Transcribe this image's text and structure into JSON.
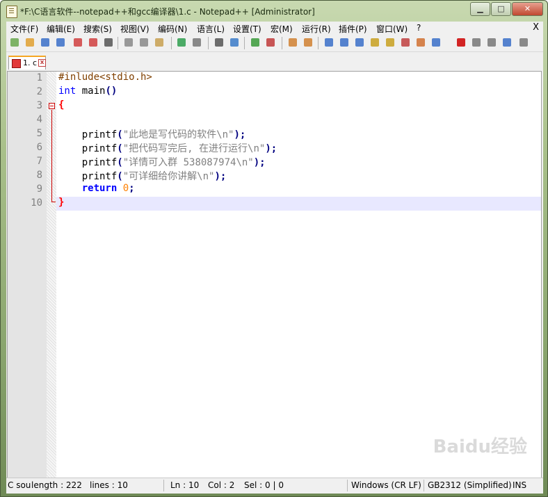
{
  "window": {
    "title": "*F:\\C语言软件--notepad++和gcc编译器\\1.c - Notepad++ [Administrator]",
    "minimize": "▁",
    "maximize": "□",
    "close": "✕"
  },
  "menu": {
    "items": [
      "文件(F)",
      "编辑(E)",
      "搜索(S)",
      "视图(V)",
      "编码(N)",
      "语言(L)",
      "设置(T)",
      "宏(M)",
      "运行(R)",
      "插件(P)",
      "窗口(W)",
      "?"
    ],
    "close_label": "X"
  },
  "toolbar": {
    "icons": [
      "new-file-icon",
      "open-file-icon",
      "save-icon",
      "save-all-icon",
      "close-icon",
      "close-all-icon",
      "print-icon",
      "cut-icon",
      "copy-icon",
      "paste-icon",
      "undo-icon",
      "redo-icon",
      "find-icon",
      "replace-icon",
      "zoom-in-icon",
      "zoom-out-icon",
      "sync-vertical-icon",
      "sync-horizontal-icon",
      "word-wrap-icon",
      "show-all-chars-icon",
      "indent-guide-icon",
      "udl-icon",
      "doc-map-icon",
      "function-list-icon",
      "folder-workspace-icon",
      "monitoring-icon",
      "record-macro-icon",
      "stop-record-icon",
      "play-macro-icon",
      "run-macro-multiple-icon",
      "save-macro-icon"
    ]
  },
  "tab": {
    "label": "1. c",
    "close": "x"
  },
  "editor": {
    "line_numbers": [
      "1",
      "2",
      "3",
      "4",
      "5",
      "6",
      "7",
      "8",
      "9",
      "10"
    ],
    "lines": {
      "l1": "#inlude<stdio.h>",
      "l2_kw": "int",
      "l2_rest": " main",
      "l2_paren": "()",
      "l3": "{",
      "l6_fn": "    printf",
      "l6_open": "(",
      "l6_str": "\"此地是写代码的软件\\n\"",
      "l6_close": ");",
      "l7_fn": "    printf",
      "l7_open": "(",
      "l7_str": "\"把代码写完后, 在进行运行\\n\"",
      "l7_close": ");",
      "l8_fn": "    printf",
      "l8_open": "(",
      "l8_str": "\"详情可入群 538087974\\n\"",
      "l8_close": ");",
      "l9_fn": "    printf",
      "l9_open": "(",
      "l9_str": "\"可详细给你讲解\\n\"",
      "l9_close": ");",
      "l10_kw": "    return",
      "l10_num": " 0",
      "l10_semi": ";",
      "l11": "}"
    }
  },
  "status": {
    "type": "C sou",
    "length": "length : 222",
    "lines": "lines : 10",
    "ln": "Ln : 10",
    "col": "Col : 2",
    "sel": "Sel : 0 | 0",
    "eol": "Windows (CR LF)",
    "encoding": "GB2312 (Simplified)",
    "mode": "INS"
  },
  "watermark": "Baidu经验"
}
